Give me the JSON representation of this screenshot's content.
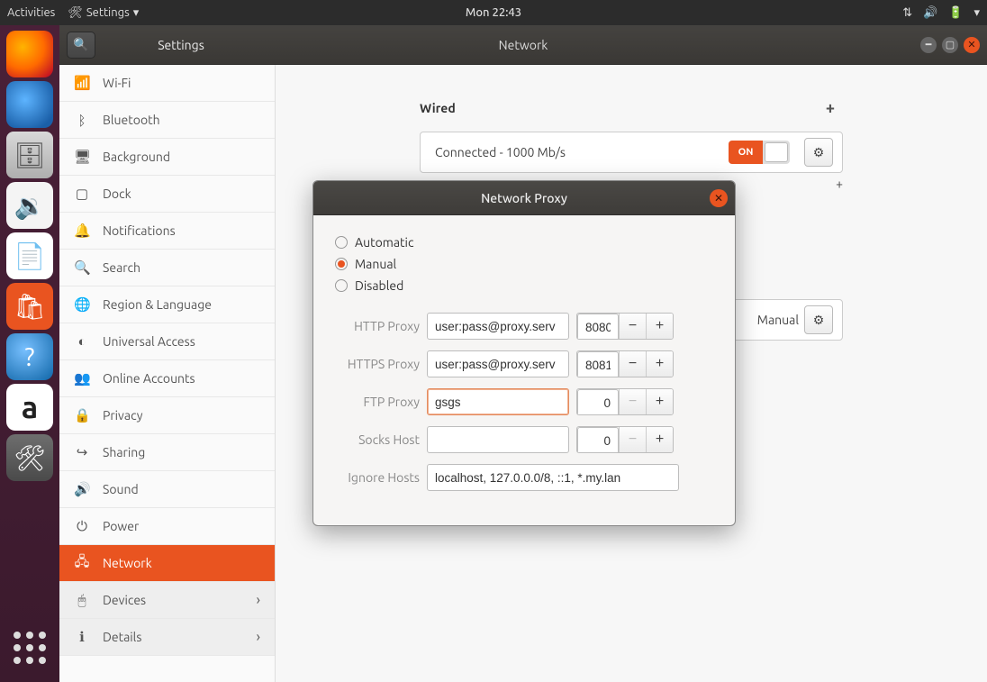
{
  "topbar": {
    "activities": "Activities",
    "app_menu": "Settings",
    "clock": "Mon 22:43"
  },
  "launcher": {
    "firefox": "Firefox",
    "thunderbird": "Thunderbird",
    "files": "Files",
    "rhythmbox": "Rhythmbox",
    "libreoffice": "LibreOffice Writer",
    "software": "Ubuntu Software",
    "help": "Help",
    "amazon": "Amazon",
    "settings": "Settings",
    "apps": "Show Applications"
  },
  "window": {
    "sidebar_title": "Settings",
    "main_title": "Network"
  },
  "sidebar": {
    "items": [
      {
        "icon": "📶",
        "label": "Wi-Fi"
      },
      {
        "icon": "ᛒ",
        "label": "Bluetooth"
      },
      {
        "icon": "🖥",
        "label": "Background"
      },
      {
        "icon": "▢",
        "label": "Dock"
      },
      {
        "icon": "🔔",
        "label": "Notifications"
      },
      {
        "icon": "🔍",
        "label": "Search"
      },
      {
        "icon": "🌐",
        "label": "Region & Language"
      },
      {
        "icon": "◐",
        "label": "Universal Access"
      },
      {
        "icon": "👥",
        "label": "Online Accounts"
      },
      {
        "icon": "🔒",
        "label": "Privacy"
      },
      {
        "icon": "↪",
        "label": "Sharing"
      },
      {
        "icon": "🔊",
        "label": "Sound"
      },
      {
        "icon": "⏻",
        "label": "Power"
      },
      {
        "icon": "🖧",
        "label": "Network",
        "active": true
      },
      {
        "icon": "🖱",
        "label": "Devices",
        "caret": true,
        "sub": true
      },
      {
        "icon": "ℹ",
        "label": "Details",
        "caret": true,
        "sub": true
      }
    ]
  },
  "content": {
    "wired_header": "Wired",
    "wired_status": "Connected - 1000 Mb/s",
    "toggle_on": "ON",
    "proxy_header_manual": "Manual"
  },
  "modal": {
    "title": "Network Proxy",
    "options": {
      "automatic": "Automatic",
      "manual": "Manual",
      "disabled": "Disabled"
    },
    "selected": "manual",
    "fields": {
      "http": {
        "label": "HTTP Proxy",
        "host": "user:pass@proxy.serv",
        "port": "8080"
      },
      "https": {
        "label": "HTTPS Proxy",
        "host": "user:pass@proxy.serv",
        "port": "8081"
      },
      "ftp": {
        "label": "FTP Proxy",
        "host": "gsgs",
        "port": "0"
      },
      "socks": {
        "label": "Socks Host",
        "host": "",
        "port": "0"
      },
      "ignore": {
        "label": "Ignore Hosts",
        "value": "localhost, 127.0.0.0/8, ::1, *.my.lan"
      }
    }
  }
}
